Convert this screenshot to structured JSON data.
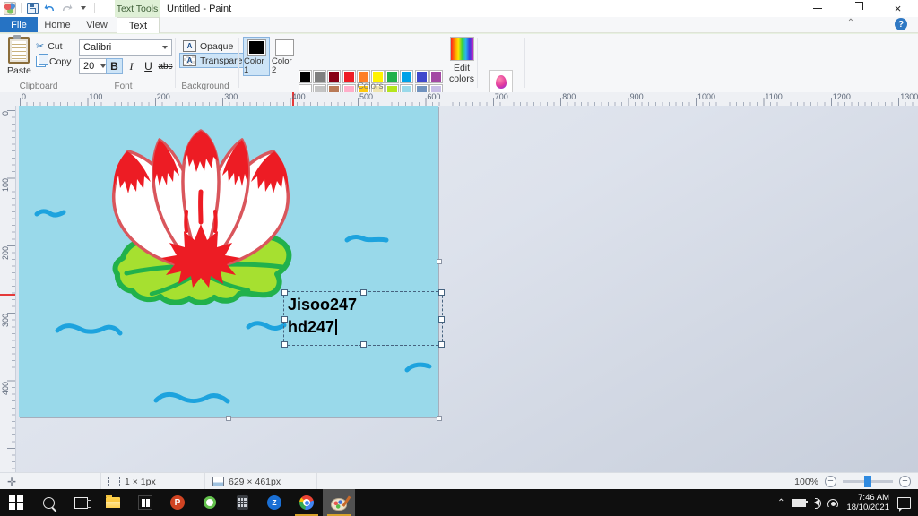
{
  "titlebar": {
    "title": "Untitled - Paint",
    "contextual_group": "Text Tools"
  },
  "tabs": {
    "file": "File",
    "home": "Home",
    "view": "View",
    "text": "Text"
  },
  "ribbon": {
    "clipboard": {
      "section_label": "Clipboard",
      "paste_label": "Paste",
      "cut_label": "Cut",
      "copy_label": "Copy"
    },
    "font": {
      "section_label": "Font",
      "family": "Calibri",
      "size": "20",
      "bold_label": "B",
      "italic_label": "I",
      "underline_label": "U",
      "strikethrough_label": "abc"
    },
    "background": {
      "section_label": "Background",
      "opaque_label": "Opaque",
      "transparent_label": "Transparent"
    },
    "colors": {
      "section_label": "Colors",
      "color1_label": "Color 1",
      "color1_value": "#000000",
      "color2_label": "Color 2",
      "color2_value": "#ffffff",
      "palette_row1": [
        "#000000",
        "#7f7f7f",
        "#880015",
        "#ed1c24",
        "#ff7f27",
        "#fff200",
        "#22b14c",
        "#00a2e8",
        "#3f48cc",
        "#a349a4"
      ],
      "palette_row2": [
        "#ffffff",
        "#c3c3c3",
        "#b97a57",
        "#ffaec9",
        "#ffc90e",
        "#efe4b0",
        "#b5e61d",
        "#99d9ea",
        "#7092be",
        "#c8bfe7"
      ],
      "custom_color": "#f0595f",
      "empty_slot_count": 9,
      "edit_colors_label": "Edit colors",
      "edit_paint3d_label": "Edit with Paint 3D"
    },
    "help_label": "?"
  },
  "ruler": {
    "horizontal_labels": [
      "0",
      "100",
      "200",
      "300",
      "400",
      "500",
      "600",
      "700",
      "800",
      "900",
      "1000",
      "1100",
      "1200",
      "1300"
    ],
    "vertical_labels": [
      "0",
      "100",
      "200",
      "300",
      "400"
    ]
  },
  "canvas": {
    "background_color": "#99d9ea",
    "text_line1": "Jisoo247",
    "text_line2": "hd247"
  },
  "statusbar": {
    "selection_size": "1 × 1px",
    "image_size": "629 × 461px",
    "zoom_level": "100%"
  },
  "taskbar": {
    "tray_time": "7:46 AM",
    "tray_date": "18/10/2021"
  }
}
